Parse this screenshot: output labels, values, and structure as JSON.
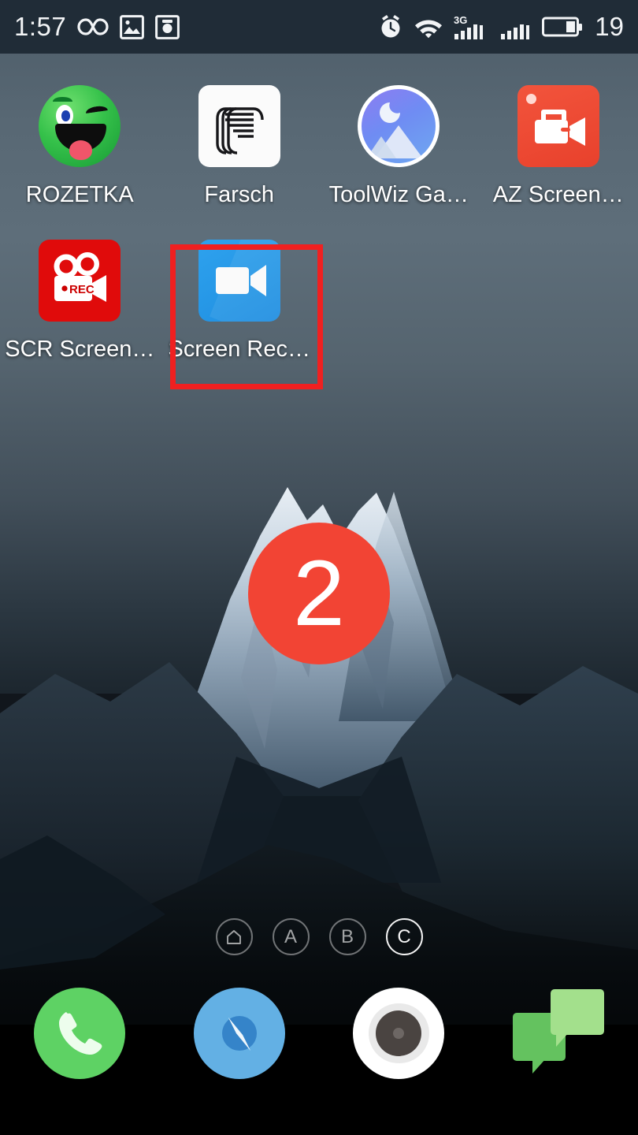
{
  "status_bar": {
    "time": "1:57",
    "battery_percent": "19",
    "left_icons": [
      "infinity-icon",
      "photo-icon",
      "camera-icon"
    ],
    "right_icons": [
      "alarm-icon",
      "wifi-icon",
      "signal-3g-icon",
      "signal-icon",
      "battery-icon"
    ],
    "network_label": "3G",
    "background_color": "#202c37"
  },
  "apps": {
    "rows": [
      [
        {
          "label": "ROZETKA",
          "icon": "rozetka-icon"
        },
        {
          "label": "Farsch",
          "icon": "farsch-icon"
        },
        {
          "label": "ToolWiz Ga…",
          "icon": "toolwiz-gallery-icon"
        },
        {
          "label": "AZ Screen…",
          "icon": "az-screen-recorder-icon"
        }
      ],
      [
        {
          "label": "SCR Screen…",
          "icon": "scr-screen-recorder-icon"
        },
        {
          "label": "Screen Rec…",
          "icon": "screen-recorder-icon"
        }
      ]
    ]
  },
  "highlight": {
    "target_label": "Screen Rec…",
    "color": "#f02020"
  },
  "badge": {
    "text": "2",
    "color": "#f24434"
  },
  "page_indicators": {
    "items": [
      {
        "label": "⌂",
        "name": "home",
        "active": false
      },
      {
        "label": "A",
        "name": "page-a",
        "active": false
      },
      {
        "label": "B",
        "name": "page-b",
        "active": false
      },
      {
        "label": "C",
        "name": "page-c",
        "active": true
      }
    ]
  },
  "dock": {
    "items": [
      {
        "name": "phone-icon",
        "label": "Phone"
      },
      {
        "name": "browser-icon",
        "label": "Browser"
      },
      {
        "name": "camera-icon",
        "label": "Camera"
      },
      {
        "name": "messaging-icon",
        "label": "Messaging"
      }
    ]
  }
}
